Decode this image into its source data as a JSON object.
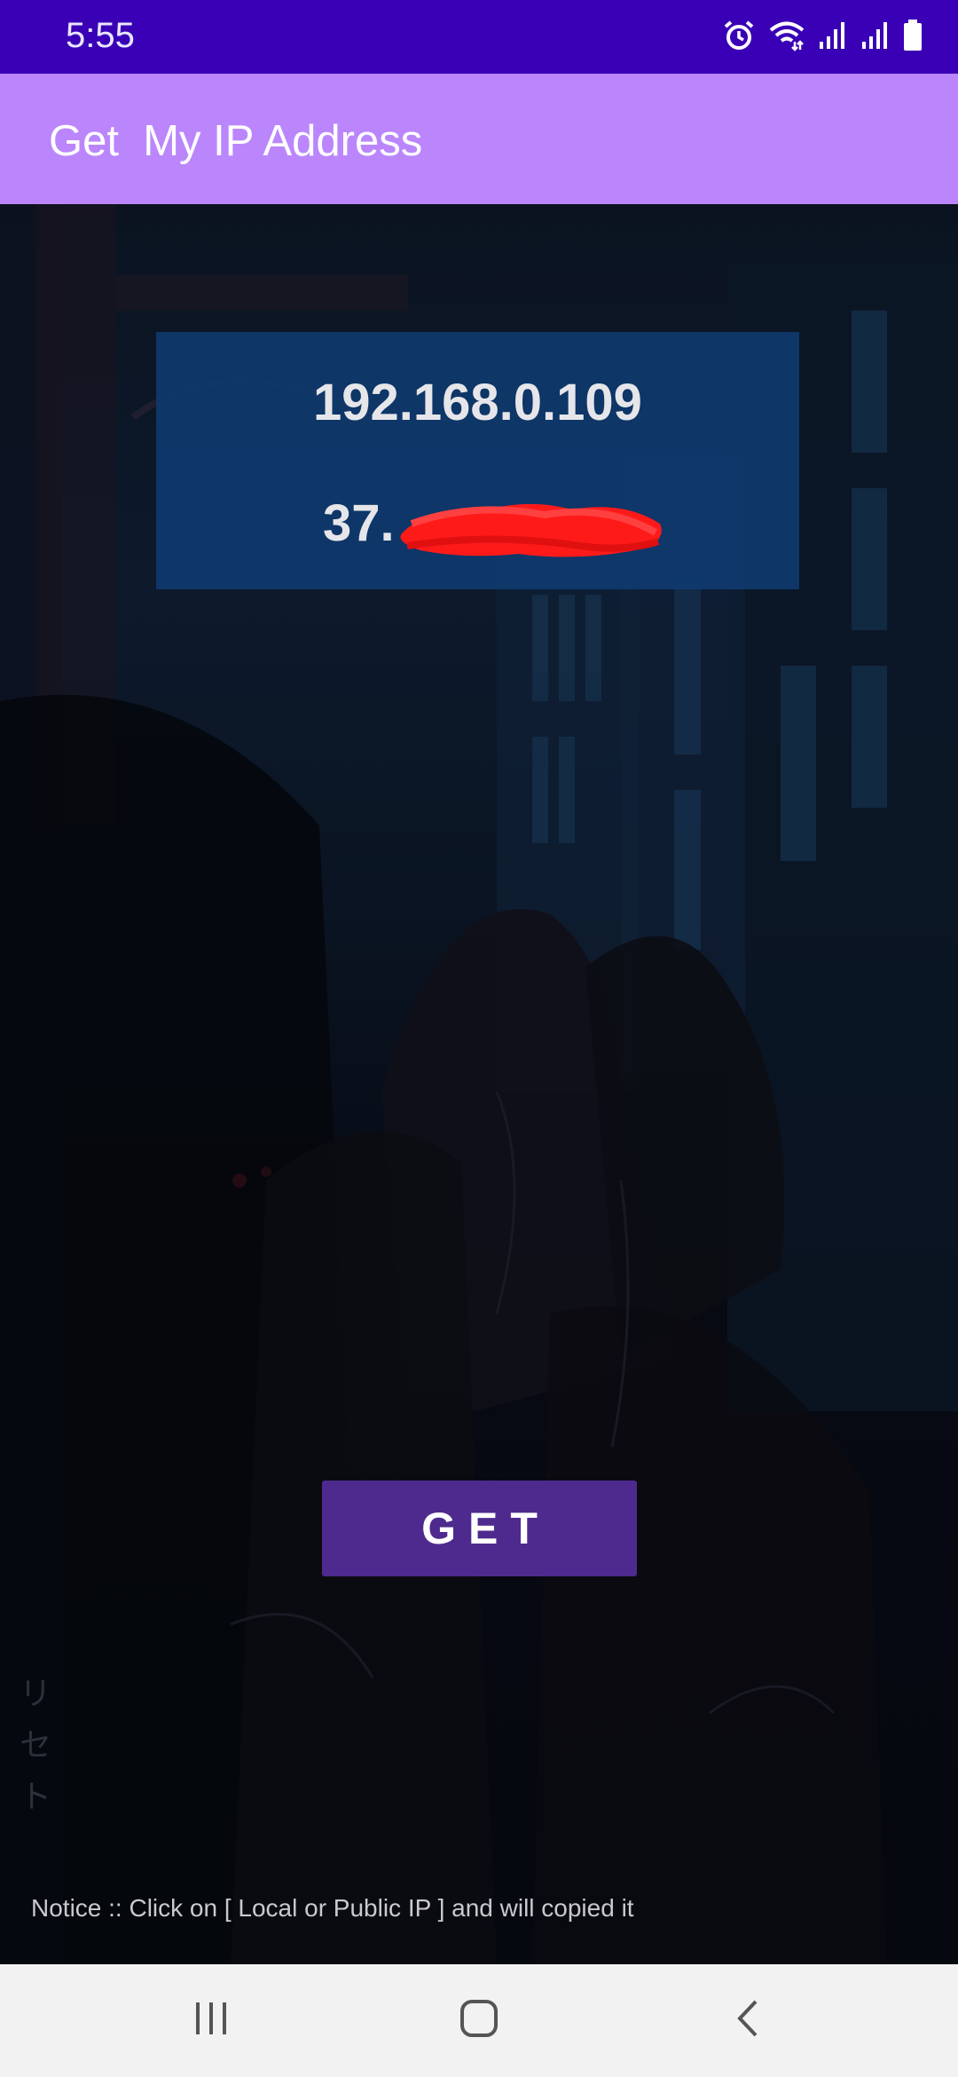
{
  "status_bar": {
    "time": "5:55",
    "icons": [
      "alarm-icon",
      "wifi-icon",
      "signal-icon-1",
      "signal-icon-2",
      "battery-icon"
    ]
  },
  "app_bar": {
    "title": "Get  My IP Address",
    "color": "#bb86fc"
  },
  "ip_panel": {
    "local_ip": "192.168.0.109",
    "public_ip_visible_prefix": "37."
  },
  "get_button": {
    "label": "GET",
    "color": "#4e2a8e"
  },
  "background": {
    "vertical_text": "リセト"
  },
  "notice": {
    "text": "Notice :: Click on [ Local or Public IP ] and will copied it"
  },
  "nav_bar": {
    "items": [
      "recent-apps-icon",
      "home-icon",
      "back-icon"
    ]
  },
  "colors": {
    "status_bar": "#3a00b6",
    "redaction": "#ff1a1a"
  }
}
